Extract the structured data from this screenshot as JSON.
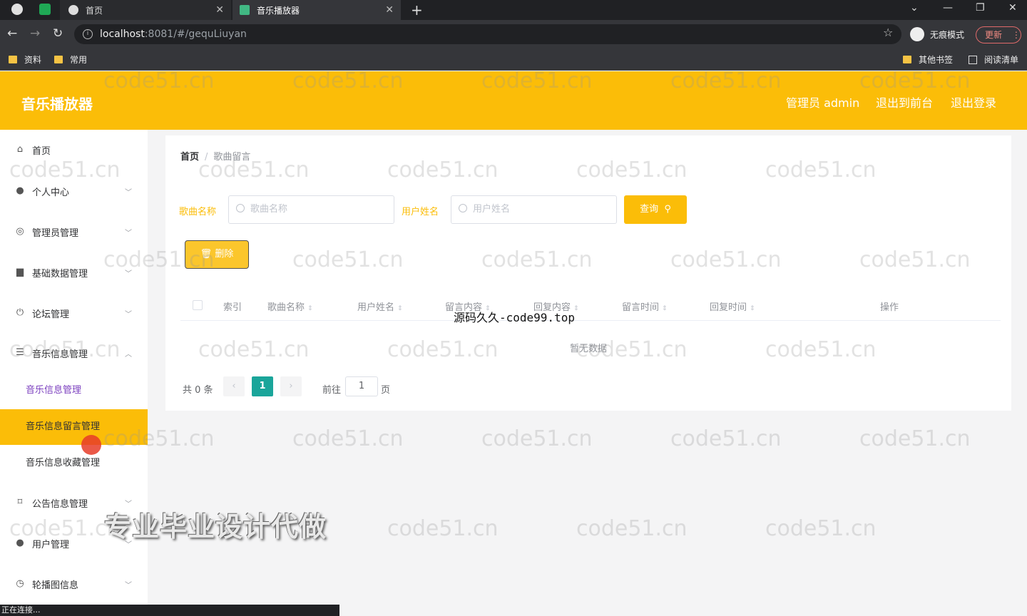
{
  "browser": {
    "tabs": [
      {
        "label": "首页"
      },
      {
        "label": "音乐播放器"
      }
    ],
    "url_host": "localhost",
    "url_rest": ":8081/#/gequLiuyan",
    "incognito_label": "无痕模式",
    "update_label": "更新",
    "bookmarks": [
      "资料",
      "常用"
    ],
    "bookmarks_right": [
      "其他书签",
      "阅读清单"
    ],
    "status_text": "正在连接..."
  },
  "header": {
    "title": "音乐播放器",
    "admin_label": "管理员 admin",
    "to_front": "退出到前台",
    "logout": "退出登录"
  },
  "sidebar": {
    "items": [
      {
        "label": "首页",
        "icon": "home-icon"
      },
      {
        "label": "个人中心",
        "icon": "user-icon"
      },
      {
        "label": "管理员管理",
        "icon": "compass-icon"
      },
      {
        "label": "基础数据管理",
        "icon": "folder-icon"
      },
      {
        "label": "论坛管理",
        "icon": "power-icon"
      },
      {
        "label": "音乐信息管理",
        "icon": "menu-icon"
      },
      {
        "label": "公告信息管理",
        "icon": "crop-icon"
      },
      {
        "label": "用户管理",
        "icon": "user-icon"
      },
      {
        "label": "轮播图信息",
        "icon": "clock-icon"
      }
    ],
    "subitems": [
      {
        "label": "音乐信息管理"
      },
      {
        "label": "音乐信息留言管理"
      },
      {
        "label": "音乐信息收藏管理"
      }
    ]
  },
  "breadcrumb": {
    "home": "首页",
    "current": "歌曲留言"
  },
  "search": {
    "song_label": "歌曲名称",
    "song_placeholder": "歌曲名称",
    "user_label": "用户姓名",
    "user_placeholder": "用户姓名",
    "query_button": "查询"
  },
  "actions": {
    "delete_button": "删除"
  },
  "table": {
    "columns": [
      "索引",
      "歌曲名称",
      "用户姓名",
      "留言内容",
      "回复内容",
      "留言时间",
      "回复时间",
      "操作"
    ],
    "empty_text": "暂无数据"
  },
  "pagination": {
    "total_text": "共 0 条",
    "current_page": "1",
    "goto_label": "前往",
    "goto_value": "1",
    "page_suffix": "页"
  },
  "overlays": {
    "center_watermark": "源码久久-code99.top",
    "banner": "专业毕业设计代做",
    "tile_watermark": "code51.cn"
  },
  "colors": {
    "accent": "#fbbd08",
    "pager_active": "#1aa59a"
  }
}
